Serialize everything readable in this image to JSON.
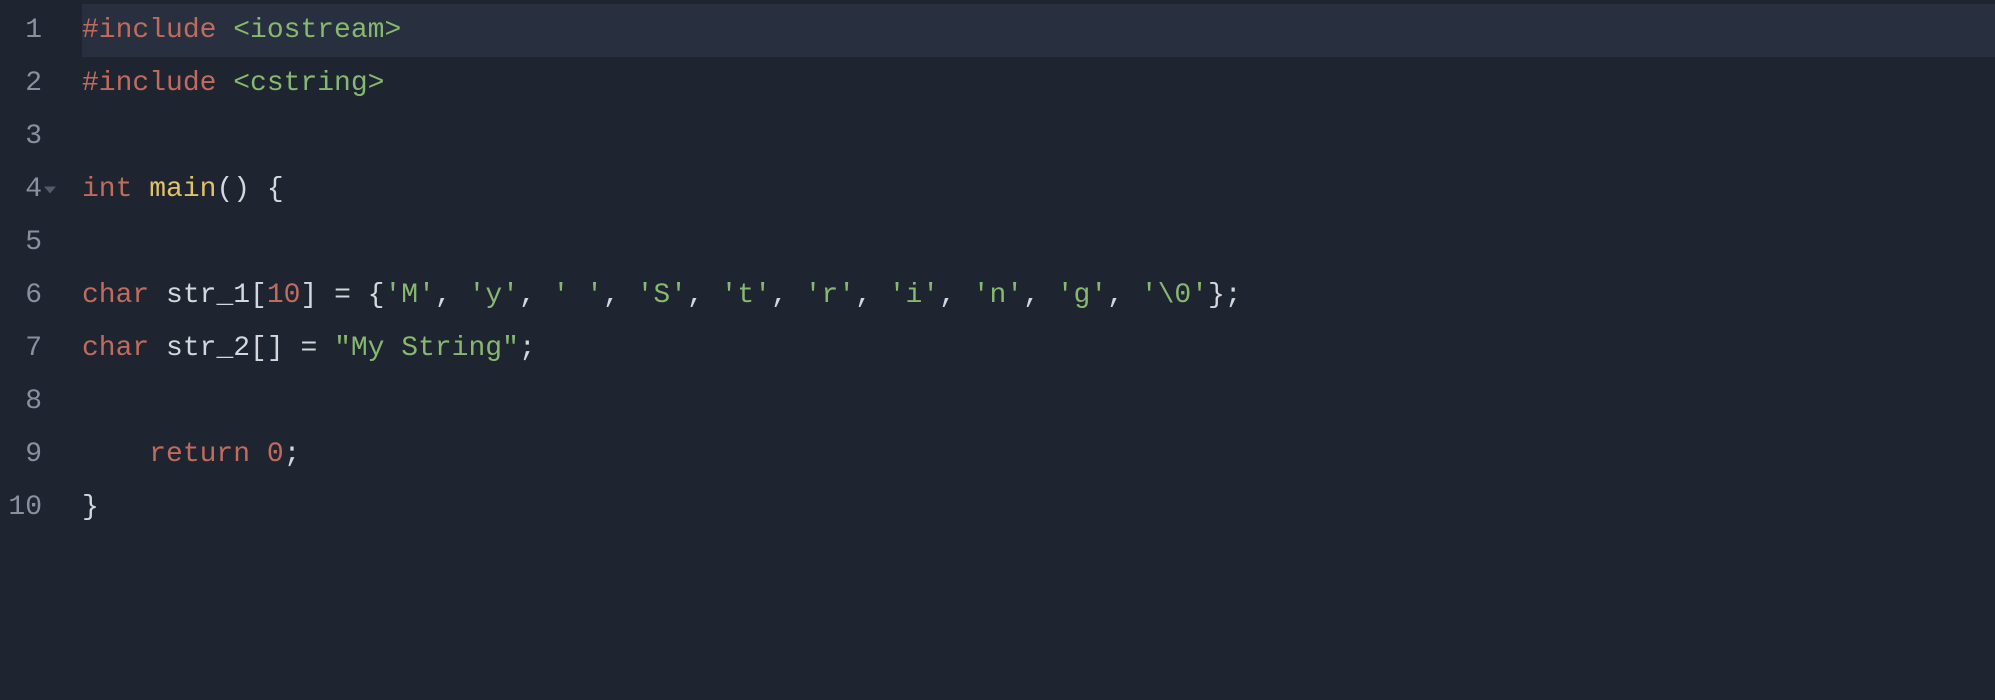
{
  "editor": {
    "current_line": 1,
    "lines": [
      {
        "num": "1",
        "foldable": false,
        "tokens": [
          {
            "cls": "tok-directive",
            "text": "#include "
          },
          {
            "cls": "tok-string",
            "text": "<iostream>"
          }
        ]
      },
      {
        "num": "2",
        "foldable": false,
        "tokens": [
          {
            "cls": "tok-directive",
            "text": "#include "
          },
          {
            "cls": "tok-string",
            "text": "<cstring>"
          }
        ]
      },
      {
        "num": "3",
        "foldable": false,
        "tokens": []
      },
      {
        "num": "4",
        "foldable": true,
        "tokens": [
          {
            "cls": "tok-type",
            "text": "int"
          },
          {
            "cls": "tok-punct",
            "text": " "
          },
          {
            "cls": "tok-func",
            "text": "main"
          },
          {
            "cls": "tok-punct",
            "text": "() "
          },
          {
            "cls": "tok-brace",
            "text": "{"
          }
        ]
      },
      {
        "num": "5",
        "foldable": false,
        "tokens": []
      },
      {
        "num": "6",
        "foldable": false,
        "tokens": [
          {
            "cls": "tok-type",
            "text": "char"
          },
          {
            "cls": "tok-punct",
            "text": " "
          },
          {
            "cls": "tok-ident",
            "text": "str_1"
          },
          {
            "cls": "tok-punct",
            "text": "["
          },
          {
            "cls": "tok-num",
            "text": "10"
          },
          {
            "cls": "tok-punct",
            "text": "] = {"
          },
          {
            "cls": "tok-char",
            "text": "'M'"
          },
          {
            "cls": "tok-punct",
            "text": ", "
          },
          {
            "cls": "tok-char",
            "text": "'y'"
          },
          {
            "cls": "tok-punct",
            "text": ", "
          },
          {
            "cls": "tok-char",
            "text": "' '"
          },
          {
            "cls": "tok-punct",
            "text": ", "
          },
          {
            "cls": "tok-char",
            "text": "'S'"
          },
          {
            "cls": "tok-punct",
            "text": ", "
          },
          {
            "cls": "tok-char",
            "text": "'t'"
          },
          {
            "cls": "tok-punct",
            "text": ", "
          },
          {
            "cls": "tok-char",
            "text": "'r'"
          },
          {
            "cls": "tok-punct",
            "text": ", "
          },
          {
            "cls": "tok-char",
            "text": "'i'"
          },
          {
            "cls": "tok-punct",
            "text": ", "
          },
          {
            "cls": "tok-char",
            "text": "'n'"
          },
          {
            "cls": "tok-punct",
            "text": ", "
          },
          {
            "cls": "tok-char",
            "text": "'g'"
          },
          {
            "cls": "tok-punct",
            "text": ", "
          },
          {
            "cls": "tok-char",
            "text": "'\\0'"
          },
          {
            "cls": "tok-punct",
            "text": "};"
          }
        ]
      },
      {
        "num": "7",
        "foldable": false,
        "tokens": [
          {
            "cls": "tok-type",
            "text": "char"
          },
          {
            "cls": "tok-punct",
            "text": " "
          },
          {
            "cls": "tok-ident",
            "text": "str_2"
          },
          {
            "cls": "tok-punct",
            "text": "[] = "
          },
          {
            "cls": "tok-char",
            "text": "\"My String\""
          },
          {
            "cls": "tok-punct",
            "text": ";"
          }
        ]
      },
      {
        "num": "8",
        "foldable": false,
        "tokens": []
      },
      {
        "num": "9",
        "foldable": false,
        "tokens": [
          {
            "cls": "tok-punct",
            "text": "    "
          },
          {
            "cls": "tok-keyword",
            "text": "return"
          },
          {
            "cls": "tok-punct",
            "text": " "
          },
          {
            "cls": "tok-num",
            "text": "0"
          },
          {
            "cls": "tok-punct",
            "text": ";"
          }
        ]
      },
      {
        "num": "10",
        "foldable": false,
        "tokens": [
          {
            "cls": "tok-brace",
            "text": "}"
          }
        ]
      }
    ]
  }
}
